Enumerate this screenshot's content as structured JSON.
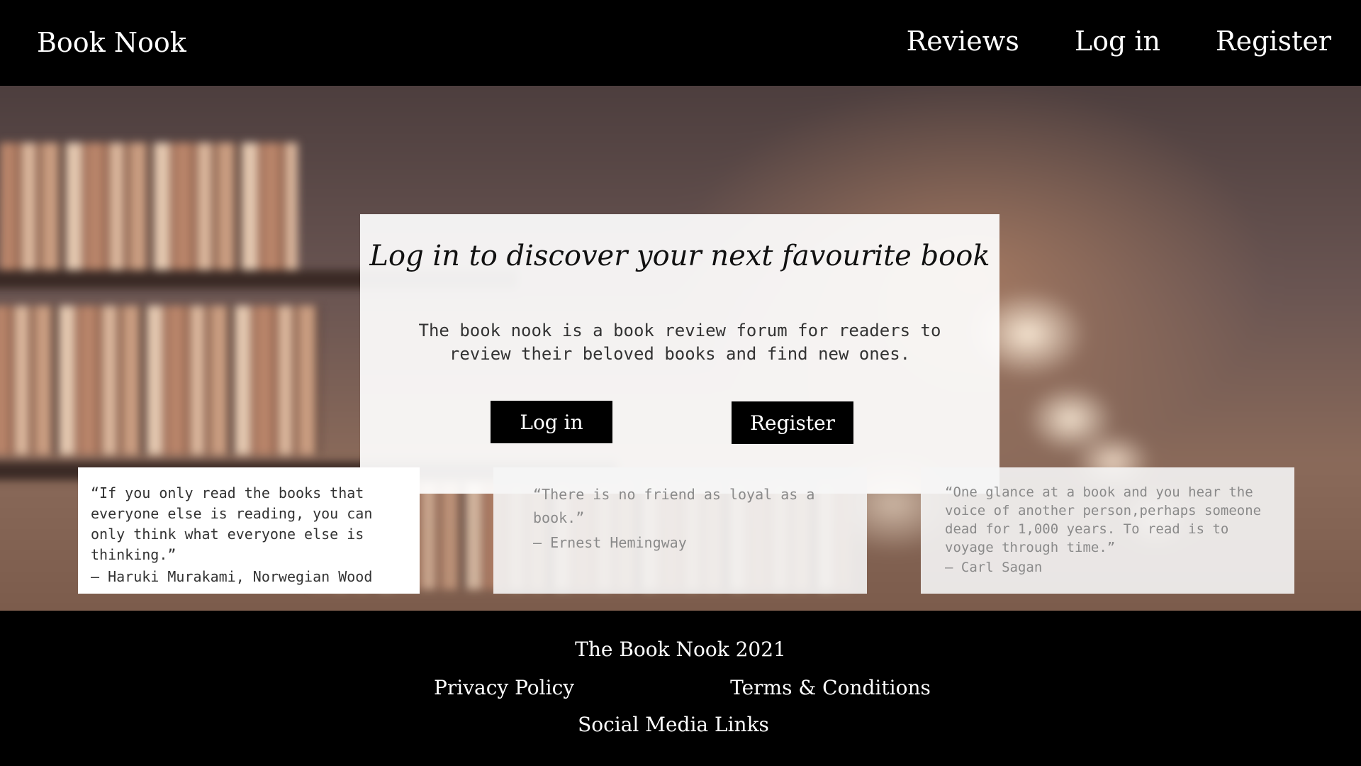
{
  "header": {
    "brand": "Book Nook",
    "nav": [
      "Reviews",
      "Log in",
      "Register"
    ]
  },
  "login_card": {
    "heading": "Log in to discover your next favourite book",
    "description": "The book nook is a book review forum for readers to review their beloved books and find new ones.",
    "login_button": "Log in",
    "register_button": "Register"
  },
  "quotes": [
    {
      "text": "“If you only read the books that everyone else is reading, you can only think what everyone else is thinking.”",
      "author": "― Haruki Murakami, Norwegian Wood"
    },
    {
      "text": "“There is no friend as loyal as a book.”",
      "author": "― Ernest Hemingway"
    },
    {
      "text": "“One glance at a book and you hear the voice of another person,perhaps someone dead for 1,000 years. To read is to voyage through time.”",
      "author": "― Carl Sagan"
    }
  ],
  "footer": {
    "copyright": "The Book Nook 2021",
    "privacy": "Privacy Policy",
    "terms": "Terms & Conditions",
    "social": "Social Media Links"
  },
  "colors": {
    "header_bg": "#000000",
    "footer_bg": "#000000",
    "button_bg": "#000000",
    "card_bg": "#ffffff"
  }
}
